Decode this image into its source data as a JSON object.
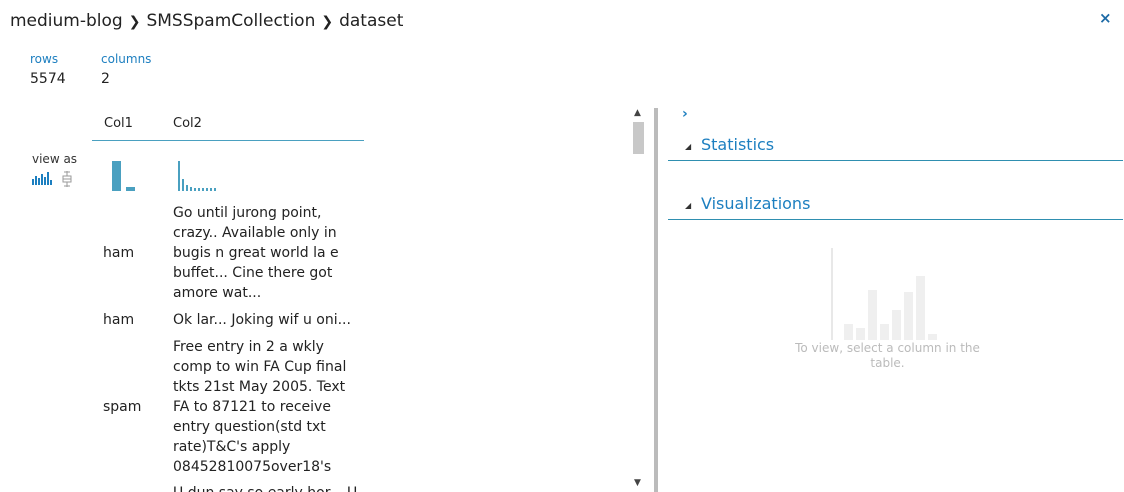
{
  "breadcrumb": {
    "items": [
      "medium-blog",
      "SMSSpamCollection",
      "dataset"
    ],
    "separator": "❯"
  },
  "close": {
    "label": "×"
  },
  "stats": {
    "rows": {
      "label": "rows",
      "value": "5574"
    },
    "columns": {
      "label": "columns",
      "value": "2"
    }
  },
  "view_as": {
    "label": "view as",
    "icons": [
      "histogram-icon",
      "boxplot-icon"
    ]
  },
  "table": {
    "columns": [
      "Col1",
      "Col2"
    ],
    "rows": [
      [
        "ham",
        "Go until jurong point, crazy.. Available only in bugis n great world la e buffet... Cine there got amore wat..."
      ],
      [
        "ham",
        "Ok lar... Joking wif u oni..."
      ],
      [
        "spam",
        "Free entry in 2 a wkly comp to win FA Cup final tkts 21st May 2005. Text FA to 87121 to receive entry question(std txt rate)T&C's apply 08452810075over18's"
      ],
      [
        "",
        "U dun say so early hor... U"
      ]
    ]
  },
  "panel": {
    "expand_icon": "chevron-right-icon",
    "statistics": {
      "title": "Statistics"
    },
    "visualizations": {
      "title": "Visualizations"
    },
    "placeholder_text": "To view, select a column in the table."
  },
  "colors": {
    "accent": "#1d7fc0",
    "rule": "#2f8fb0",
    "bar": "#4aa0c0"
  }
}
